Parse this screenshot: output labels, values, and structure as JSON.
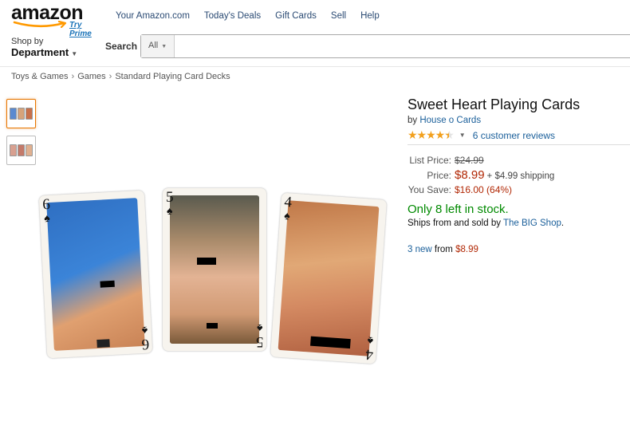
{
  "header": {
    "logo_text": "amazon",
    "try_prime": "Try Prime",
    "nav": [
      "Your Amazon.com",
      "Today's Deals",
      "Gift Cards",
      "Sell",
      "Help"
    ],
    "shop_by_line1": "Shop by",
    "shop_by_line2": "Department",
    "search_label": "Search",
    "search_category": "All",
    "search_value": ""
  },
  "breadcrumb": [
    "Toys & Games",
    "Games",
    "Standard Playing Card Decks"
  ],
  "breadcrumb_sep": "›",
  "gallery": {
    "cards": [
      {
        "rank": "6",
        "suit": "♠"
      },
      {
        "rank": "5",
        "suit": "♠"
      },
      {
        "rank": "4",
        "suit": "♠"
      }
    ]
  },
  "product": {
    "title": "Sweet Heart Playing Cards",
    "by_prefix": "by",
    "brand": "House o Cards",
    "rating": 4.5,
    "reviews_text": "6 customer reviews",
    "list_price_label": "List Price:",
    "list_price": "$24.99",
    "price_label": "Price:",
    "price": "$8.99",
    "shipping": "+ $4.99 shipping",
    "you_save_label": "You Save:",
    "you_save": "$16.00 (64%)",
    "stock": "Only 8 left in stock.",
    "ships_prefix": "Ships from and sold by",
    "seller": "The BIG Shop",
    "ships_suffix": ".",
    "new_count": "3 new",
    "from_word": "from",
    "new_price": "$8.99"
  },
  "colors": {
    "price_red": "#b12704",
    "stock_green": "#008a00",
    "link_blue": "#1a5f9a",
    "star_orange": "#f2a01d",
    "thumb_selected": "#e77600"
  }
}
